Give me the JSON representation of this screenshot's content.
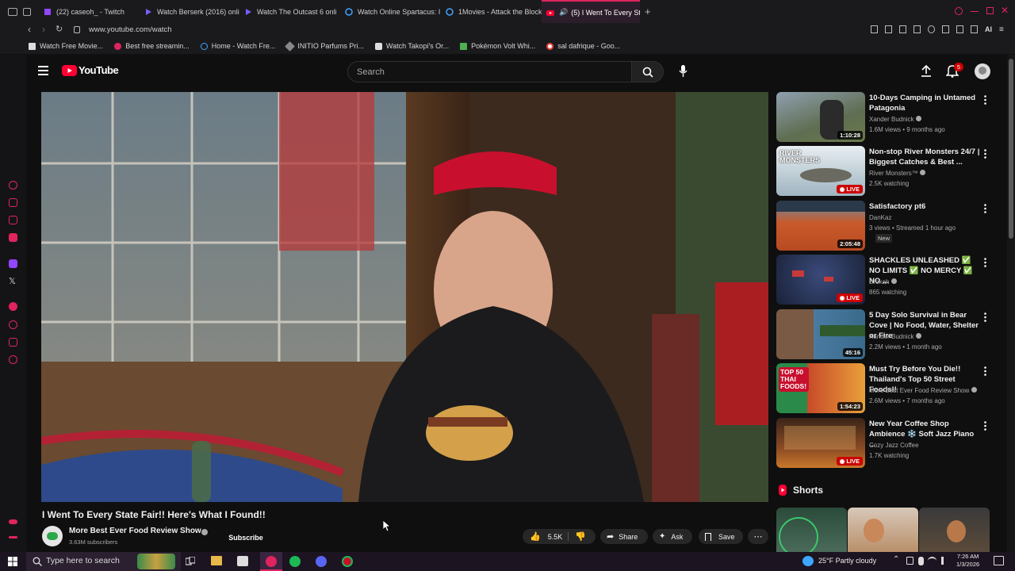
{
  "browser": {
    "tabs": [
      {
        "label": "(22) caseoh_ - Twitch",
        "icon": "twitch-icon"
      },
      {
        "label": "Watch Berserk (2016) onli",
        "icon": "play-icon"
      },
      {
        "label": "Watch The Outcast 6 onli",
        "icon": "play-icon"
      },
      {
        "label": "Watch Online Spartacus: I",
        "icon": "globe-icon"
      },
      {
        "label": "1Movies - Attack the Block",
        "icon": "globe-icon"
      },
      {
        "label": "(5) I Went To Every Sta",
        "icon": "youtube-icon"
      }
    ],
    "url": "www.youtube.com/watch",
    "bookmarks": [
      "Watch Free Movie...",
      "Best free streamin...",
      "Home - Watch Fre...",
      "INITIO Parfums Pri...",
      "Watch Takopi's Or...",
      "Pokémon Volt Whi...",
      "sal dafrique - Goo..."
    ],
    "toolbar_right_label": "AI"
  },
  "youtube": {
    "logo_text": "YouTube",
    "search_placeholder": "Search",
    "notification_count": "5",
    "video": {
      "title": "I Went To Every State Fair!! Here's What I Found!!",
      "channel": "More Best Ever Food Review Show",
      "subscribers": "3.63M subscribers",
      "subscribe_label": "Subscribe",
      "likes": "5.5K",
      "share_label": "Share",
      "ask_label": "Ask",
      "save_label": "Save"
    },
    "recommendations": [
      {
        "title": "10-Days Camping in Untamed Patagonia",
        "channel": "Xander Budnick",
        "verified": true,
        "meta": "1.6M views • 9 months ago",
        "badge": "1:10:28",
        "live": false,
        "extra": ""
      },
      {
        "title": "Non-stop River Monsters 24/7 | Biggest Catches & Best ...",
        "channel": "River Monsters™",
        "verified": true,
        "meta": "2.5K watching",
        "badge": "LIVE",
        "live": true,
        "extra": ""
      },
      {
        "title": "Satisfactory pt6",
        "channel": "DanKaz",
        "verified": false,
        "meta": "3 views • Streamed 1 hour ago",
        "badge": "2:05:48",
        "live": false,
        "extra": "New"
      },
      {
        "title": "SHACKLES UNLEASHED ✅ NO LIMITS ✅ NO MERCY ✅ NO ...",
        "channel": "Broxah",
        "verified": true,
        "meta": "865 watching",
        "badge": "LIVE",
        "live": true,
        "extra": ""
      },
      {
        "title": "5 Day Solo Survival in Bear Cove | No Food, Water, Shelter or Fire",
        "channel": "Xander Budnick",
        "verified": true,
        "meta": "2.2M views • 1 month ago",
        "badge": "45:16",
        "live": false,
        "extra": ""
      },
      {
        "title": "Must Try Before You Die!! Thailand's Top 50 Street Foods!!",
        "channel": "More Best Ever Food Review Show",
        "verified": true,
        "meta": "2.6M views • 7 months ago",
        "badge": "1:54:23",
        "live": false,
        "extra": ""
      },
      {
        "title": "New Year Coffee Shop Ambience ❄️ Soft Jazz Piano ...",
        "channel": "Cozy Jazz Coffee",
        "verified": false,
        "meta": "1.7K watching",
        "badge": "LIVE",
        "live": true,
        "extra": ""
      }
    ],
    "thumb_text": {
      "river_monsters": "RIVER MONSTERS",
      "thai_foods": "TOP 50 THAI FOODS!"
    },
    "shorts_label": "Shorts"
  },
  "taskbar": {
    "search_placeholder": "Type here to search",
    "weather": "25°F  Partly cloudy",
    "time": "7:26 AM",
    "date": "1/3/2026"
  },
  "colors": {
    "accent": "#ff0033",
    "live": "#cc0000",
    "tab_accent": "#e0245e"
  }
}
